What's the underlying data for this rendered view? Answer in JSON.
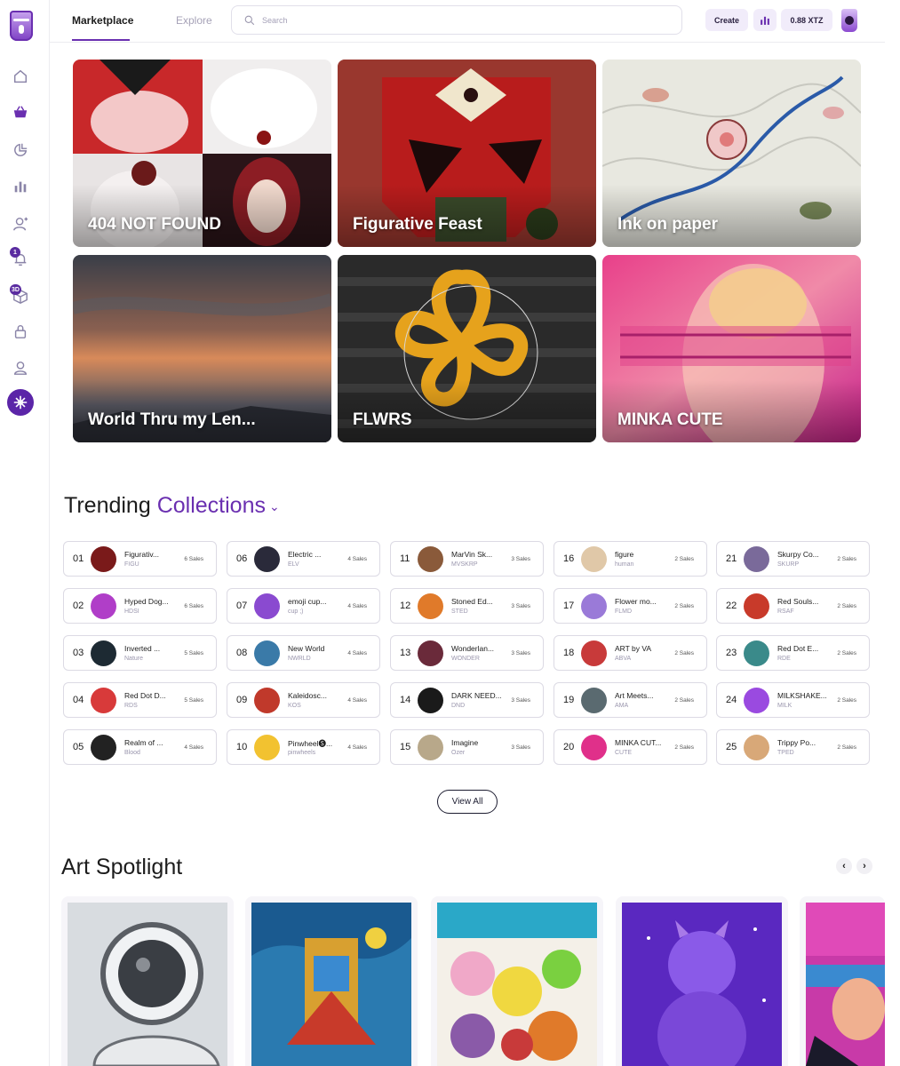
{
  "header": {
    "tabs": [
      {
        "label": "Marketplace",
        "active": true
      },
      {
        "label": "Explore",
        "active": false
      }
    ],
    "search_placeholder": "Search",
    "create_label": "Create",
    "balance": "0.88 XTZ"
  },
  "sidebar": {
    "items": [
      {
        "icon": "home-icon"
      },
      {
        "icon": "basket-icon",
        "active": true
      },
      {
        "icon": "chart-arc-icon"
      },
      {
        "icon": "bar-chart-icon"
      },
      {
        "icon": "user-add-icon"
      },
      {
        "icon": "bell-icon",
        "badge": "1"
      },
      {
        "icon": "cube-icon",
        "badge": "3D"
      },
      {
        "icon": "lock-icon"
      },
      {
        "icon": "user-icon"
      },
      {
        "icon": "network-icon"
      }
    ]
  },
  "banners": [
    {
      "label": "404 NOT FOUND"
    },
    {
      "label": "Figurative Feast"
    },
    {
      "label": "Ink on paper"
    },
    {
      "label": "World Thru my Len..."
    },
    {
      "label": "FLWRS"
    },
    {
      "label": "MINKA CUTE"
    }
  ],
  "trending": {
    "title_prefix": "Trending",
    "title_accent": "Collections",
    "view_all": "View All",
    "items": [
      {
        "rank": "01",
        "name": "Figurativ...",
        "symbol": "FIGU",
        "sales": "6 Sales",
        "color": "#7a1a1a"
      },
      {
        "rank": "02",
        "name": "Hyped Dog...",
        "symbol": "HDSI",
        "sales": "6 Sales",
        "color": "#b03ec8"
      },
      {
        "rank": "03",
        "name": "Inverted ...",
        "symbol": "Nature",
        "sales": "5 Sales",
        "color": "#1d2a33"
      },
      {
        "rank": "04",
        "name": "Red Dot D...",
        "symbol": "RDS",
        "sales": "5 Sales",
        "color": "#d83a3a"
      },
      {
        "rank": "05",
        "name": "Realm of ...",
        "symbol": "Blood",
        "sales": "4 Sales",
        "color": "#222222"
      },
      {
        "rank": "06",
        "name": "Electric ...",
        "symbol": "ELV",
        "sales": "4 Sales",
        "color": "#2a2a3a"
      },
      {
        "rank": "07",
        "name": "emoji cup...",
        "symbol": "cup ;)",
        "sales": "4 Sales",
        "color": "#8a4ad0"
      },
      {
        "rank": "08",
        "name": "New World",
        "symbol": "NWRLD",
        "sales": "4 Sales",
        "color": "#3a7aa8"
      },
      {
        "rank": "09",
        "name": "Kaleidosc...",
        "symbol": "KOS",
        "sales": "4 Sales",
        "color": "#c0392b"
      },
      {
        "rank": "10",
        "name": "Pinwheel🅢...",
        "symbol": "pinwheels",
        "sales": "4 Sales",
        "color": "#f2c230"
      },
      {
        "rank": "11",
        "name": "MarVin Sk...",
        "symbol": "MVSKRP",
        "sales": "3 Sales",
        "color": "#8a5a3a"
      },
      {
        "rank": "12",
        "name": "Stoned Ed...",
        "symbol": "STED",
        "sales": "3 Sales",
        "color": "#e07a2a"
      },
      {
        "rank": "13",
        "name": "Wonderlan...",
        "symbol": "WONDER",
        "sales": "3 Sales",
        "color": "#6a2a3a"
      },
      {
        "rank": "14",
        "name": "DARK NEED...",
        "symbol": "DND",
        "sales": "3 Sales",
        "color": "#1a1a1a"
      },
      {
        "rank": "15",
        "name": "Imagine",
        "symbol": "Ozer",
        "sales": "3 Sales",
        "color": "#b8a88a"
      },
      {
        "rank": "16",
        "name": "figure",
        "symbol": "human",
        "sales": "2 Sales",
        "color": "#e0c8a8"
      },
      {
        "rank": "17",
        "name": "Flower mo...",
        "symbol": "FLMD",
        "sales": "2 Sales",
        "color": "#9a7ad8"
      },
      {
        "rank": "18",
        "name": "ART by VA",
        "symbol": "ABVA",
        "sales": "2 Sales",
        "color": "#c83a3a"
      },
      {
        "rank": "19",
        "name": "Art Meets...",
        "symbol": "AMA",
        "sales": "2 Sales",
        "color": "#5a6a70"
      },
      {
        "rank": "20",
        "name": "MINKA CUT...",
        "symbol": "CUTE",
        "sales": "2 Sales",
        "color": "#e0308a"
      },
      {
        "rank": "21",
        "name": "Skurpy Co...",
        "symbol": "SKURP",
        "sales": "2 Sales",
        "color": "#7a6a9a"
      },
      {
        "rank": "22",
        "name": "Red Souls...",
        "symbol": "RSAF",
        "sales": "2 Sales",
        "color": "#c83a2a"
      },
      {
        "rank": "23",
        "name": "Red Dot E...",
        "symbol": "RDE",
        "sales": "2 Sales",
        "color": "#3a8a8a"
      },
      {
        "rank": "24",
        "name": "MILKSHAKE...",
        "symbol": "MILK",
        "sales": "2 Sales",
        "color": "#9a4ae0"
      },
      {
        "rank": "25",
        "name": "Trippy Po...",
        "symbol": "TPED",
        "sales": "2 Sales",
        "color": "#d8a878"
      }
    ]
  },
  "spotlight": {
    "title": "Art Spotlight",
    "prev": "‹",
    "next": "›"
  }
}
